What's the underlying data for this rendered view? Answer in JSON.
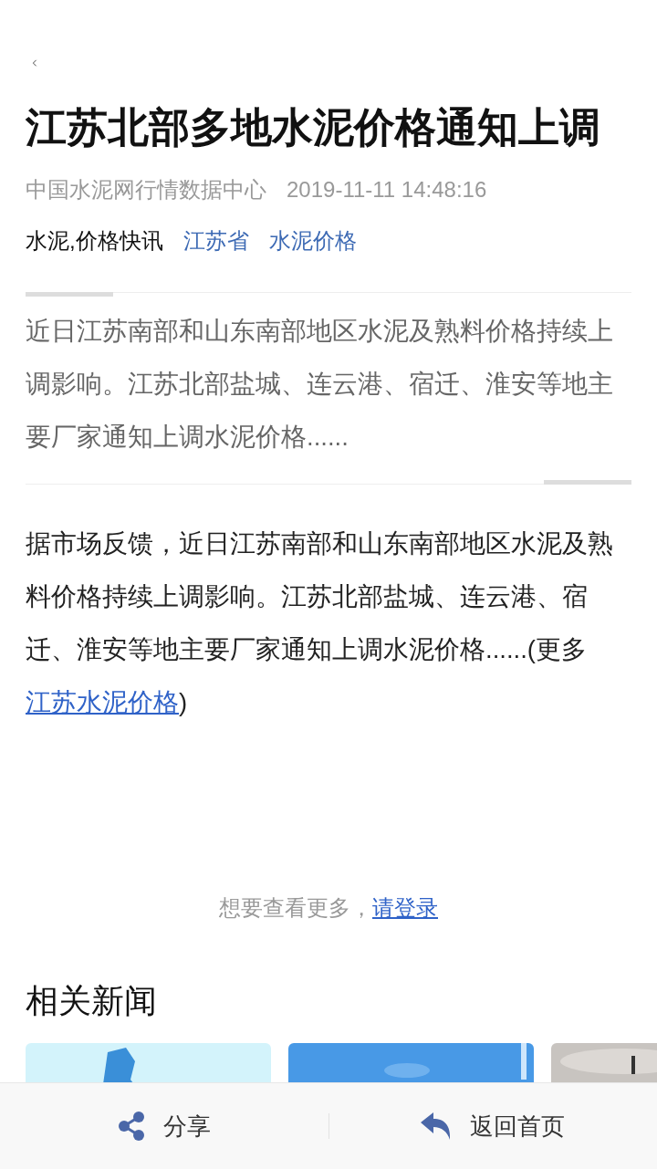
{
  "title": "江苏北部多地水泥价格通知上调",
  "source": "中国水泥网行情数据中心",
  "datetime": "2019-11-11 14:48:16",
  "category": "水泥,价格快讯",
  "tags": [
    "江苏省",
    "水泥价格"
  ],
  "summary": "近日江苏南部和山东南部地区水泥及熟料价格持续上调影响。江苏北部盐城、连云港、宿迁、淮安等地主要厂家通知上调水泥价格......",
  "body": {
    "text": "据市场反馈，近日江苏南部和山东南部地区水泥及熟料价格持续上调影响。江苏北部盐城、连云港、宿迁、淮安等地主要厂家通知上调水泥价格......(更多",
    "link": "江苏水泥价格",
    "after": ")"
  },
  "login_prompt": {
    "text": "想要查看更多，",
    "link": "请登录"
  },
  "related": {
    "heading": "相关新闻"
  },
  "bottom_bar": [
    {
      "kind": "share",
      "label": "分享"
    },
    {
      "kind": "home",
      "label": "返回首页"
    }
  ]
}
